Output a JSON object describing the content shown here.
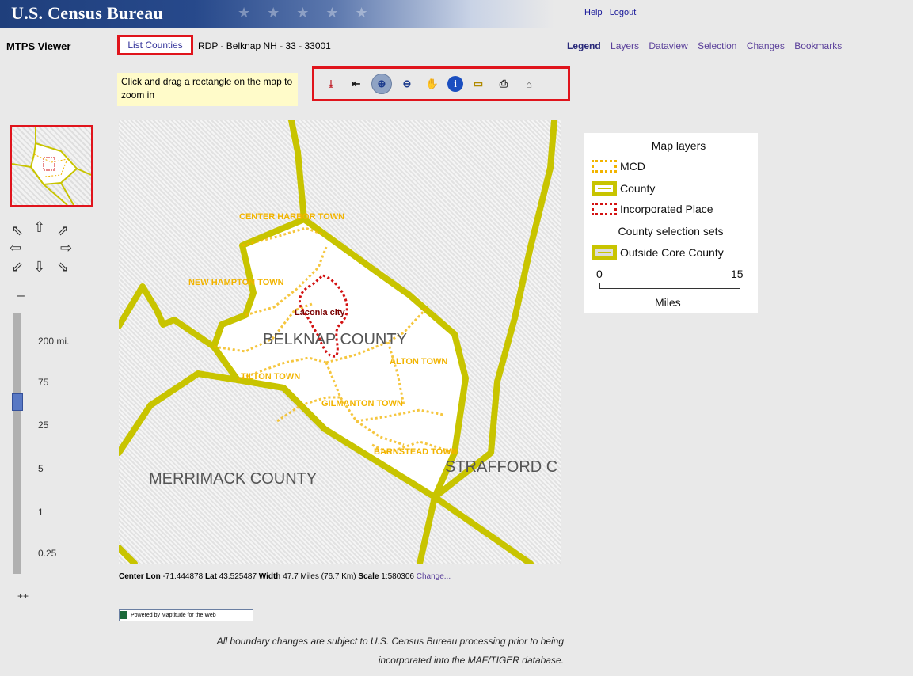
{
  "header": {
    "title": "U.S. Census Bureau",
    "links": {
      "help": "Help",
      "logout": "Logout"
    }
  },
  "nav": {
    "app_name": "MTPS Viewer",
    "list_counties": "List Counties",
    "rdp_info": "RDP - Belknap NH - 33 - 33001",
    "tabs": [
      "Legend",
      "Layers",
      "Dataview",
      "Selection",
      "Changes",
      "Bookmarks"
    ],
    "active_tab": "Legend"
  },
  "hint": "Click and drag a rectangle on the map to zoom in",
  "toolbar": {
    "tools": [
      {
        "icon": "clear-selection-icon",
        "glyph": "⤓",
        "color": "#c0202a"
      },
      {
        "icon": "back-icon",
        "glyph": "⇤",
        "color": "#1a1a1a"
      },
      {
        "icon": "zoom-in-icon",
        "glyph": "⊕",
        "color": "#1b3a8c",
        "selected": true
      },
      {
        "icon": "zoom-out-icon",
        "glyph": "⊖",
        "color": "#1b3a8c"
      },
      {
        "icon": "pan-hand-icon",
        "glyph": "✋",
        "color": "#444"
      },
      {
        "icon": "info-icon",
        "glyph": "i",
        "color": "#fff",
        "bg": "#1b4fc0"
      },
      {
        "icon": "measure-ruler-icon",
        "glyph": "▭",
        "color": "#b08a00"
      },
      {
        "icon": "print-icon",
        "glyph": "⎙",
        "color": "#333"
      },
      {
        "icon": "home-icon",
        "glyph": "⌂",
        "color": "#555"
      }
    ]
  },
  "zoom": {
    "minus": "–",
    "plus": "++",
    "labels": [
      "200 mi.",
      "75",
      "25",
      "5",
      "1",
      "0.25"
    ],
    "current_level": "75"
  },
  "map": {
    "counties": {
      "belknap": "BELKNAP COUNTY",
      "merrimack": "MERRIMACK COUNTY",
      "strafford": "STRAFFORD C"
    },
    "towns": [
      "CENTER HARBOR TOWN",
      "NEW HAMPTON TOWN",
      "TILTON TOWN",
      "ALTON TOWN",
      "GILMANTON TOWN",
      "BARNSTEAD TOWN"
    ],
    "place": "Laconia city",
    "colors": {
      "county_line": "#c8c400",
      "mcd_label": "#f2b400",
      "place_line": "#d31212",
      "place_label": "#7a0000"
    }
  },
  "legend": {
    "title": "Map layers",
    "items": [
      {
        "label": "MCD",
        "swatch": "mcd"
      },
      {
        "label": "County",
        "swatch": "county"
      },
      {
        "label": "Incorporated Place",
        "swatch": "place"
      }
    ],
    "selection_title": "County selection sets",
    "selection_item": "Outside Core County",
    "scale": {
      "min": "0",
      "max": "15",
      "unit": "Miles"
    }
  },
  "status": {
    "center_lon_label": "Center Lon",
    "center_lon": "-71.444878",
    "lat_label": "Lat",
    "lat": "43.525487",
    "width_label": "Width",
    "width": "47.7",
    "width_units": "Miles (76.7 Km)",
    "scale_label": "Scale",
    "scale": "1:580306",
    "change": "Change..."
  },
  "powered_by": "Powered by Maptitude for the Web",
  "disclaimer": {
    "line1": "All boundary changes are subject to U.S. Census Bureau processing prior to being",
    "line2": "incorporated into the MAF/TIGER database."
  }
}
